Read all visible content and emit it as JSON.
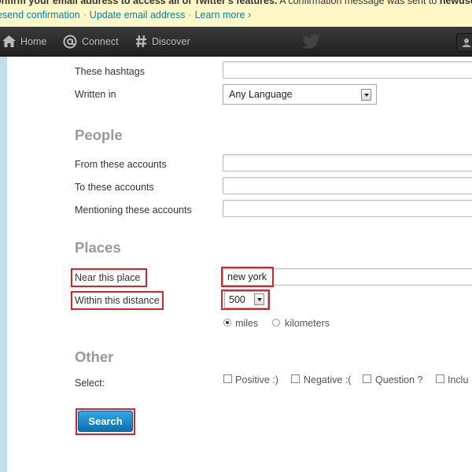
{
  "notice": {
    "line1_bold": "onfirm your email address to access all of Twitter's features.",
    "line1_rest": "A confirmation message was sent to",
    "line1_email": "newuse",
    "resend": "esend confirmation",
    "update": "Update email address",
    "learn_more": "Learn more ›",
    "separator": "·"
  },
  "nav": {
    "home": "Home",
    "connect": "Connect",
    "discover": "Discover"
  },
  "form": {
    "hashtags_label": "These hashtags",
    "written_in_label": "Written in",
    "language_value": "Any Language",
    "people_heading": "People",
    "from_label": "From these accounts",
    "to_label": "To these accounts",
    "mentioning_label": "Mentioning these accounts",
    "places_heading": "Places",
    "near_label": "Near this place",
    "near_value": "new york",
    "distance_label": "Within this distance",
    "distance_value": "500",
    "unit_miles": "miles",
    "unit_km": "kilometers",
    "unit_selected": "miles",
    "other_heading": "Other",
    "select_label": "Select:",
    "checkboxes": [
      "Positive :)",
      "Negative :(",
      "Question ?",
      "Inclu"
    ],
    "search_button": "Search"
  },
  "colors": {
    "highlight": "#d9232d",
    "link": "#0084b4",
    "button": "#1a8fd3",
    "background": "#c0deed"
  }
}
